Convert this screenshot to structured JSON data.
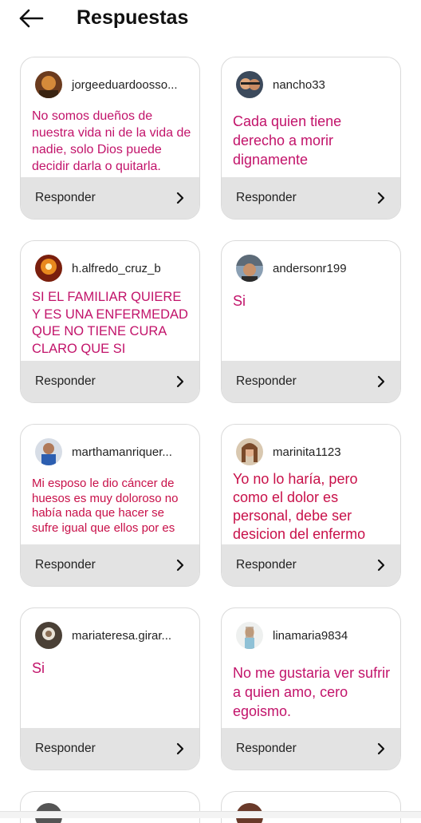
{
  "header": {
    "title": "Respuestas"
  },
  "cards": [
    {
      "username": "jorgeeduardoosso...",
      "message": "No somos dueños de nuestra vida ni de la vida de nadie, solo Dios puede decidir darla o quitarla.",
      "action": "Responder"
    },
    {
      "username": "nancho33",
      "message": "Cada quien tiene derecho a morir dignamente",
      "action": "Responder"
    },
    {
      "username": "h.alfredo_cruz_b",
      "message": "SI EL FAMILIAR QUIERE Y ES UNA ENFERMEDAD QUE NO TIENE CURA CLARO QUE SI",
      "action": "Responder"
    },
    {
      "username": "andersonr199",
      "message": "Si",
      "action": "Responder"
    },
    {
      "username": "marthamanriquer...",
      "message": "Mi esposo le dio cáncer de huesos es muy doloroso no había nada que hacer se sufre igual que ellos por es",
      "action": "Responder"
    },
    {
      "username": "marinita1123",
      "message": "Yo no lo haría, pero como el dolor es personal, debe ser desicion del enfermo",
      "action": "Responder"
    },
    {
      "username": "mariateresa.girar...",
      "message": "Si",
      "action": "Responder"
    },
    {
      "username": "linamaria9834",
      "message": "No me gustaria ver sufrir a quien amo, cero egoismo.",
      "action": "Responder"
    }
  ],
  "colors": {
    "message": "#c2136a",
    "respond_bg": "#e3e3e3"
  }
}
